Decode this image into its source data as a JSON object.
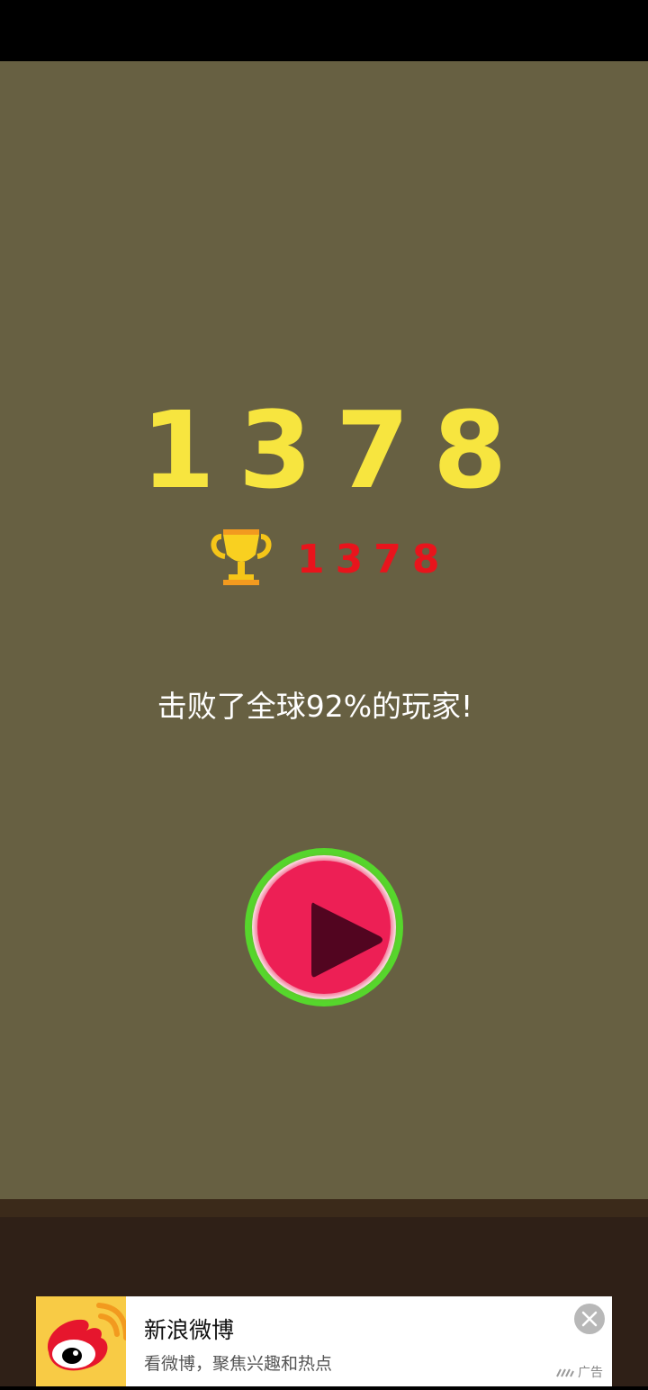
{
  "game": {
    "score": "1378",
    "best_score": "1378",
    "rank_message": "击败了全球92%的玩家!"
  },
  "ad": {
    "title": "新浪微博",
    "description": "看微博，聚焦兴趣和热点",
    "badge": "广告",
    "logo_icon": "weibo-icon",
    "close_icon": "close-icon"
  },
  "colors": {
    "game_background": "#676042",
    "floor": "#2f2017",
    "score": "#f7e53f",
    "best_score": "#e8141c",
    "play_ring": "#56d62c",
    "play_core": "#ed1f55",
    "play_triangle": "#520520"
  }
}
